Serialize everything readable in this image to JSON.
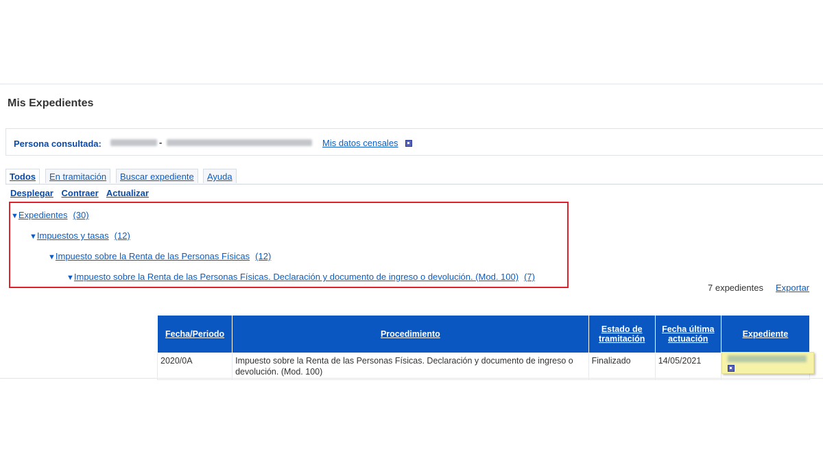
{
  "page": {
    "title": "Mis Expedientes"
  },
  "person": {
    "label": "Persona consultada:",
    "separator": "-",
    "census_link": "Mis datos censales"
  },
  "tabs": [
    {
      "label": "Todos",
      "active": true
    },
    {
      "label": "En tramitación",
      "active": false
    },
    {
      "label": "Buscar expediente",
      "active": false
    },
    {
      "label": "Ayuda",
      "active": false
    }
  ],
  "actions": {
    "expand": "Desplegar",
    "collapse": "Contraer",
    "refresh": "Actualizar"
  },
  "tree": [
    {
      "label": "Expedientes",
      "count": "(30)"
    },
    {
      "label": "Impuestos y tasas",
      "count": "(12)"
    },
    {
      "label": "Impuesto sobre la Renta de las Personas Físicas",
      "count": "(12)"
    },
    {
      "label": "Impuesto sobre la Renta de las Personas Físicas. Declaración y documento de ingreso o devolución. (Mod. 100)",
      "count": "(7)"
    }
  ],
  "summary": {
    "count_text": "7 expedientes",
    "export": "Exportar"
  },
  "table": {
    "headers": {
      "fecha": "Fecha/Periodo",
      "procedimiento": "Procedimiento",
      "estado": "Estado de tramitación",
      "ultima": "Fecha última actuación",
      "expediente": "Expediente"
    },
    "rows": [
      {
        "fecha": "2020/0A",
        "procedimiento": "Impuesto sobre la Renta de las Personas Físicas. Declaración y documento de ingreso o devolución. (Mod. 100)",
        "estado": "Finalizado",
        "ultima": "14/05/2021"
      }
    ]
  },
  "colors": {
    "link": "#0b5cc5",
    "header_bg": "#0b57c2",
    "highlight_border": "#e0202a",
    "row_highlight": "#f6f2a8"
  }
}
